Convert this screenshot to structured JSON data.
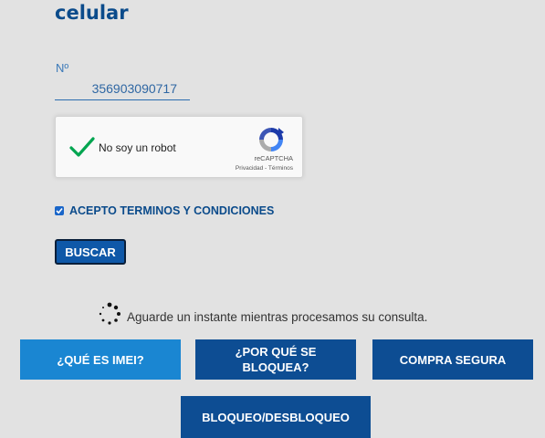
{
  "page": {
    "heading": "celular"
  },
  "form": {
    "number_label": "Nº",
    "number_value": "356903090717"
  },
  "captcha": {
    "label": "No soy un robot",
    "brand": "reCAPTCHA",
    "links": "Privacidad - Términos",
    "checked": true
  },
  "terms": {
    "label": "ACEPTO TERMINOS Y CONDICIONES",
    "checked": true
  },
  "search_button": "BUSCAR",
  "loading": {
    "text": "Aguarde un instante mientras procesamos su consulta."
  },
  "nav": {
    "what_is_imei": "¿QUÉ ES IMEI?",
    "why_blocked": "¿POR QUÉ SE BLOQUEA?",
    "safe_purchase": "COMPRA SEGURA",
    "block_unblock": "BLOQUEO/DESBLOQUEO"
  },
  "colors": {
    "heading": "#0b4b8b",
    "primary_dark": "#0d4d93",
    "primary_light": "#1a86d2",
    "check_green": "#00a550",
    "background": "#e2e2e2"
  }
}
